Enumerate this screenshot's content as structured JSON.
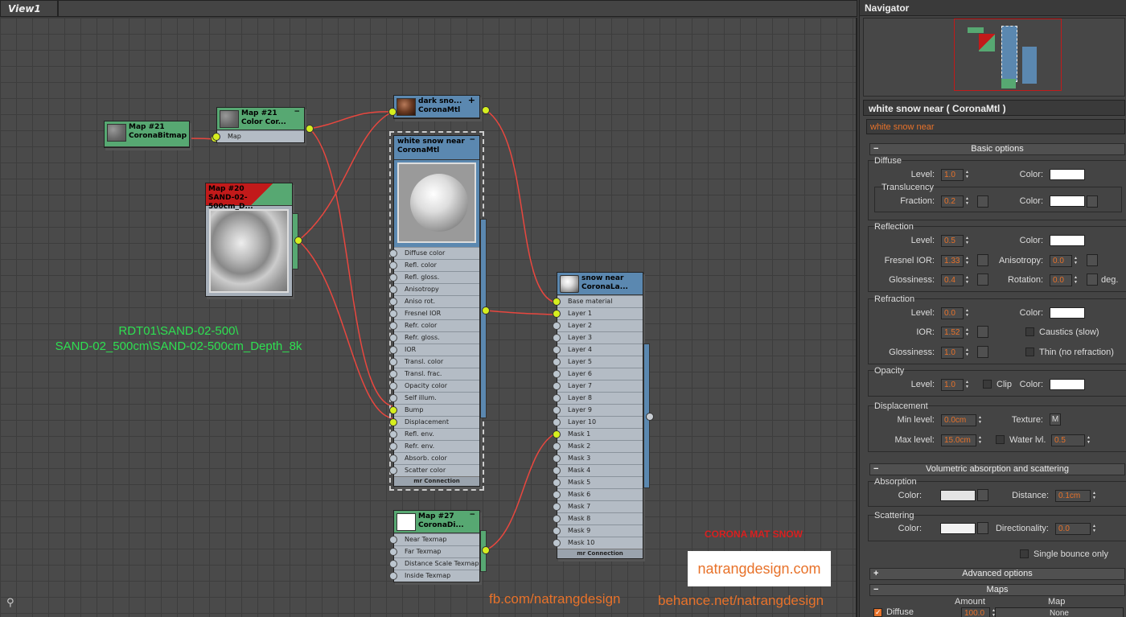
{
  "view": {
    "tab_label": "View1"
  },
  "nodes": {
    "bitmap": {
      "title1": "Map #21",
      "title2": "CoronaBitmap"
    },
    "colorcorrect": {
      "title1": "Map #21",
      "title2": "Color Cor...",
      "minus": "−",
      "slot": "Map"
    },
    "sand": {
      "title1": "Map #20",
      "title2": "SAND-02-500cm_D..."
    },
    "dark": {
      "title1": "dark sno...",
      "title2": "CoronaMtl",
      "plus": "+"
    },
    "white": {
      "title1": "white snow near",
      "title2": "CoronaMtl",
      "minus": "−",
      "slots": [
        "Diffuse color",
        "Refl. color",
        "Refl. gloss.",
        "Anisotropy",
        "Aniso rot.",
        "Fresnel IOR",
        "Refr. color",
        "Refr. gloss.",
        "IOR",
        "Transl. color",
        "Transl. frac.",
        "Opacity color",
        "Self illum.",
        "Bump",
        "Displacement",
        "Refl. env.",
        "Refr. env.",
        "Absorb. color",
        "Scatter color"
      ],
      "footer": "mr Connection"
    },
    "layered": {
      "title1": "snow near",
      "title2": "CoronaLa...",
      "slots": [
        "Base material",
        "Layer 1",
        "Layer 2",
        "Layer 3",
        "Layer 4",
        "Layer 5",
        "Layer 6",
        "Layer 7",
        "Layer 8",
        "Layer 9",
        "Layer 10",
        "Mask 1",
        "Mask 2",
        "Mask 3",
        "Mask 4",
        "Mask 5",
        "Mask 6",
        "Mask 7",
        "Mask 8",
        "Mask 9",
        "Mask 10"
      ],
      "footer": "mr Connection"
    },
    "distance": {
      "title1": "Map #27",
      "title2": "CoronaDi...",
      "minus": "−",
      "slots": [
        "Near Texmap",
        "Far Texmap",
        "Distance Scale Texmap",
        "Inside Texmap"
      ]
    }
  },
  "overlay": {
    "path_line1": "RDT01\\SAND-02-500\\",
    "path_line2": "SAND-02_500cm\\SAND-02-500cm_Depth_8k",
    "caption": "CORONA MAT SNOW",
    "logo": "natrangdesign.com",
    "fb": "fb.com/natrangdesign",
    "behance": "behance.net/natrangdesign"
  },
  "panel": {
    "navigator_title": "Navigator",
    "material_title": "white snow near  ( CoronaMtl )",
    "material_name": "white snow near",
    "basic_options": "Basic options",
    "minus": "−",
    "plus": "+",
    "diffuse": {
      "title": "Diffuse",
      "level_label": "Level:",
      "level": "1.0",
      "color_label": "Color:"
    },
    "translucency": {
      "title": "Translucency",
      "fraction_label": "Fraction:",
      "fraction": "0.2",
      "color_label": "Color:"
    },
    "reflection": {
      "title": "Reflection",
      "level_label": "Level:",
      "level": "0.5",
      "color_label": "Color:",
      "fresnel_label": "Fresnel IOR:",
      "fresnel": "1.33",
      "aniso_label": "Anisotropy:",
      "aniso": "0.0",
      "gloss_label": "Glossiness:",
      "gloss": "0.4",
      "rotation_label": "Rotation:",
      "rotation": "0.0",
      "deg": "deg."
    },
    "refraction": {
      "title": "Refraction",
      "level_label": "Level:",
      "level": "0.0",
      "color_label": "Color:",
      "ior_label": "IOR:",
      "ior": "1.52",
      "caustics": "Caustics (slow)",
      "gloss_label": "Glossiness:",
      "gloss": "1.0",
      "thin": "Thin (no refraction)"
    },
    "opacity": {
      "title": "Opacity",
      "level_label": "Level:",
      "level": "1.0",
      "clip": "Clip",
      "color_label": "Color:"
    },
    "displacement": {
      "title": "Displacement",
      "min_label": "Min level:",
      "min": "0.0cm",
      "texture_label": "Texture:",
      "texture_btn": "M",
      "max_label": "Max level:",
      "max": "15.0cm",
      "water_label": "Water lvl.",
      "water": "0.5"
    },
    "volumetric": "Volumetric absorption and scattering",
    "absorption": {
      "title": "Absorption",
      "color_label": "Color:",
      "distance_label": "Distance:",
      "distance": "0.1cm"
    },
    "scattering": {
      "title": "Scattering",
      "color_label": "Color:",
      "dir_label": "Directionality:",
      "dir": "0.0"
    },
    "single_bounce": "Single bounce only",
    "advanced": "Advanced options",
    "maps": {
      "title": "Maps",
      "amount_label": "Amount",
      "map_label": "Map",
      "diffuse": "Diffuse",
      "amount": "100.0",
      "none": "None"
    }
  },
  "colors": {
    "accent": "#e8722a",
    "wire": "#e8473f",
    "pin": "#d6ee1f",
    "material_header": "#5b88b0",
    "map_header": "#57a872"
  }
}
